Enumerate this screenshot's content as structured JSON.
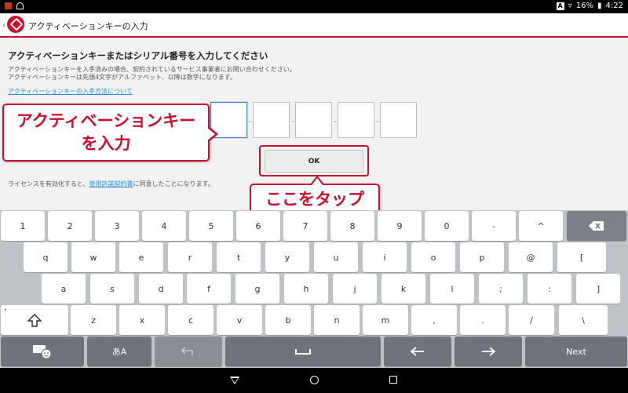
{
  "status_bar": {
    "icons": [
      "notification-icon",
      "android-icon"
    ],
    "badge": "A",
    "battery": "16%",
    "time": "4:22"
  },
  "app_bar": {
    "title": "アクティベーションキーの入力"
  },
  "form": {
    "heading": "アクティベーションキーまたはシリアル番号を入力してください",
    "note_line1": "アクティベーションキーを入手済みの場合、契約されているサービス事業者にお問い合わせください。",
    "note_line2": "アクティベーションキーは先頭4文字がアルファベット、以降は数字になります。",
    "howto_link": "アクティベーションキーの入手方法について",
    "key_fields": [
      "",
      "",
      "",
      "",
      ""
    ],
    "separator": "-",
    "ok_label": "OK",
    "license_before": "ライセンスを有効化すると、",
    "license_link": "使用許諾契約書",
    "license_after": "に同意したことになります。"
  },
  "callouts": {
    "enter_key_line1": "アクティベーションキー",
    "enter_key_line2": "を入力",
    "tap_here": "ここをタップ"
  },
  "keyboard": {
    "row1": [
      "1",
      "2",
      "3",
      "4",
      "5",
      "6",
      "7",
      "8",
      "9",
      "0",
      "-",
      "^"
    ],
    "row2": [
      "q",
      "w",
      "e",
      "r",
      "t",
      "y",
      "u",
      "i",
      "o",
      "p",
      "@",
      "["
    ],
    "row3": [
      "a",
      "s",
      "d",
      "f",
      "g",
      "h",
      "j",
      "k",
      "l",
      ";",
      ":",
      "]"
    ],
    "row4": [
      "z",
      "x",
      "c",
      "v",
      "b",
      "n",
      "m",
      ",",
      ".",
      "/",
      "\\"
    ],
    "kana_key": "あA",
    "next_label": "Next"
  }
}
